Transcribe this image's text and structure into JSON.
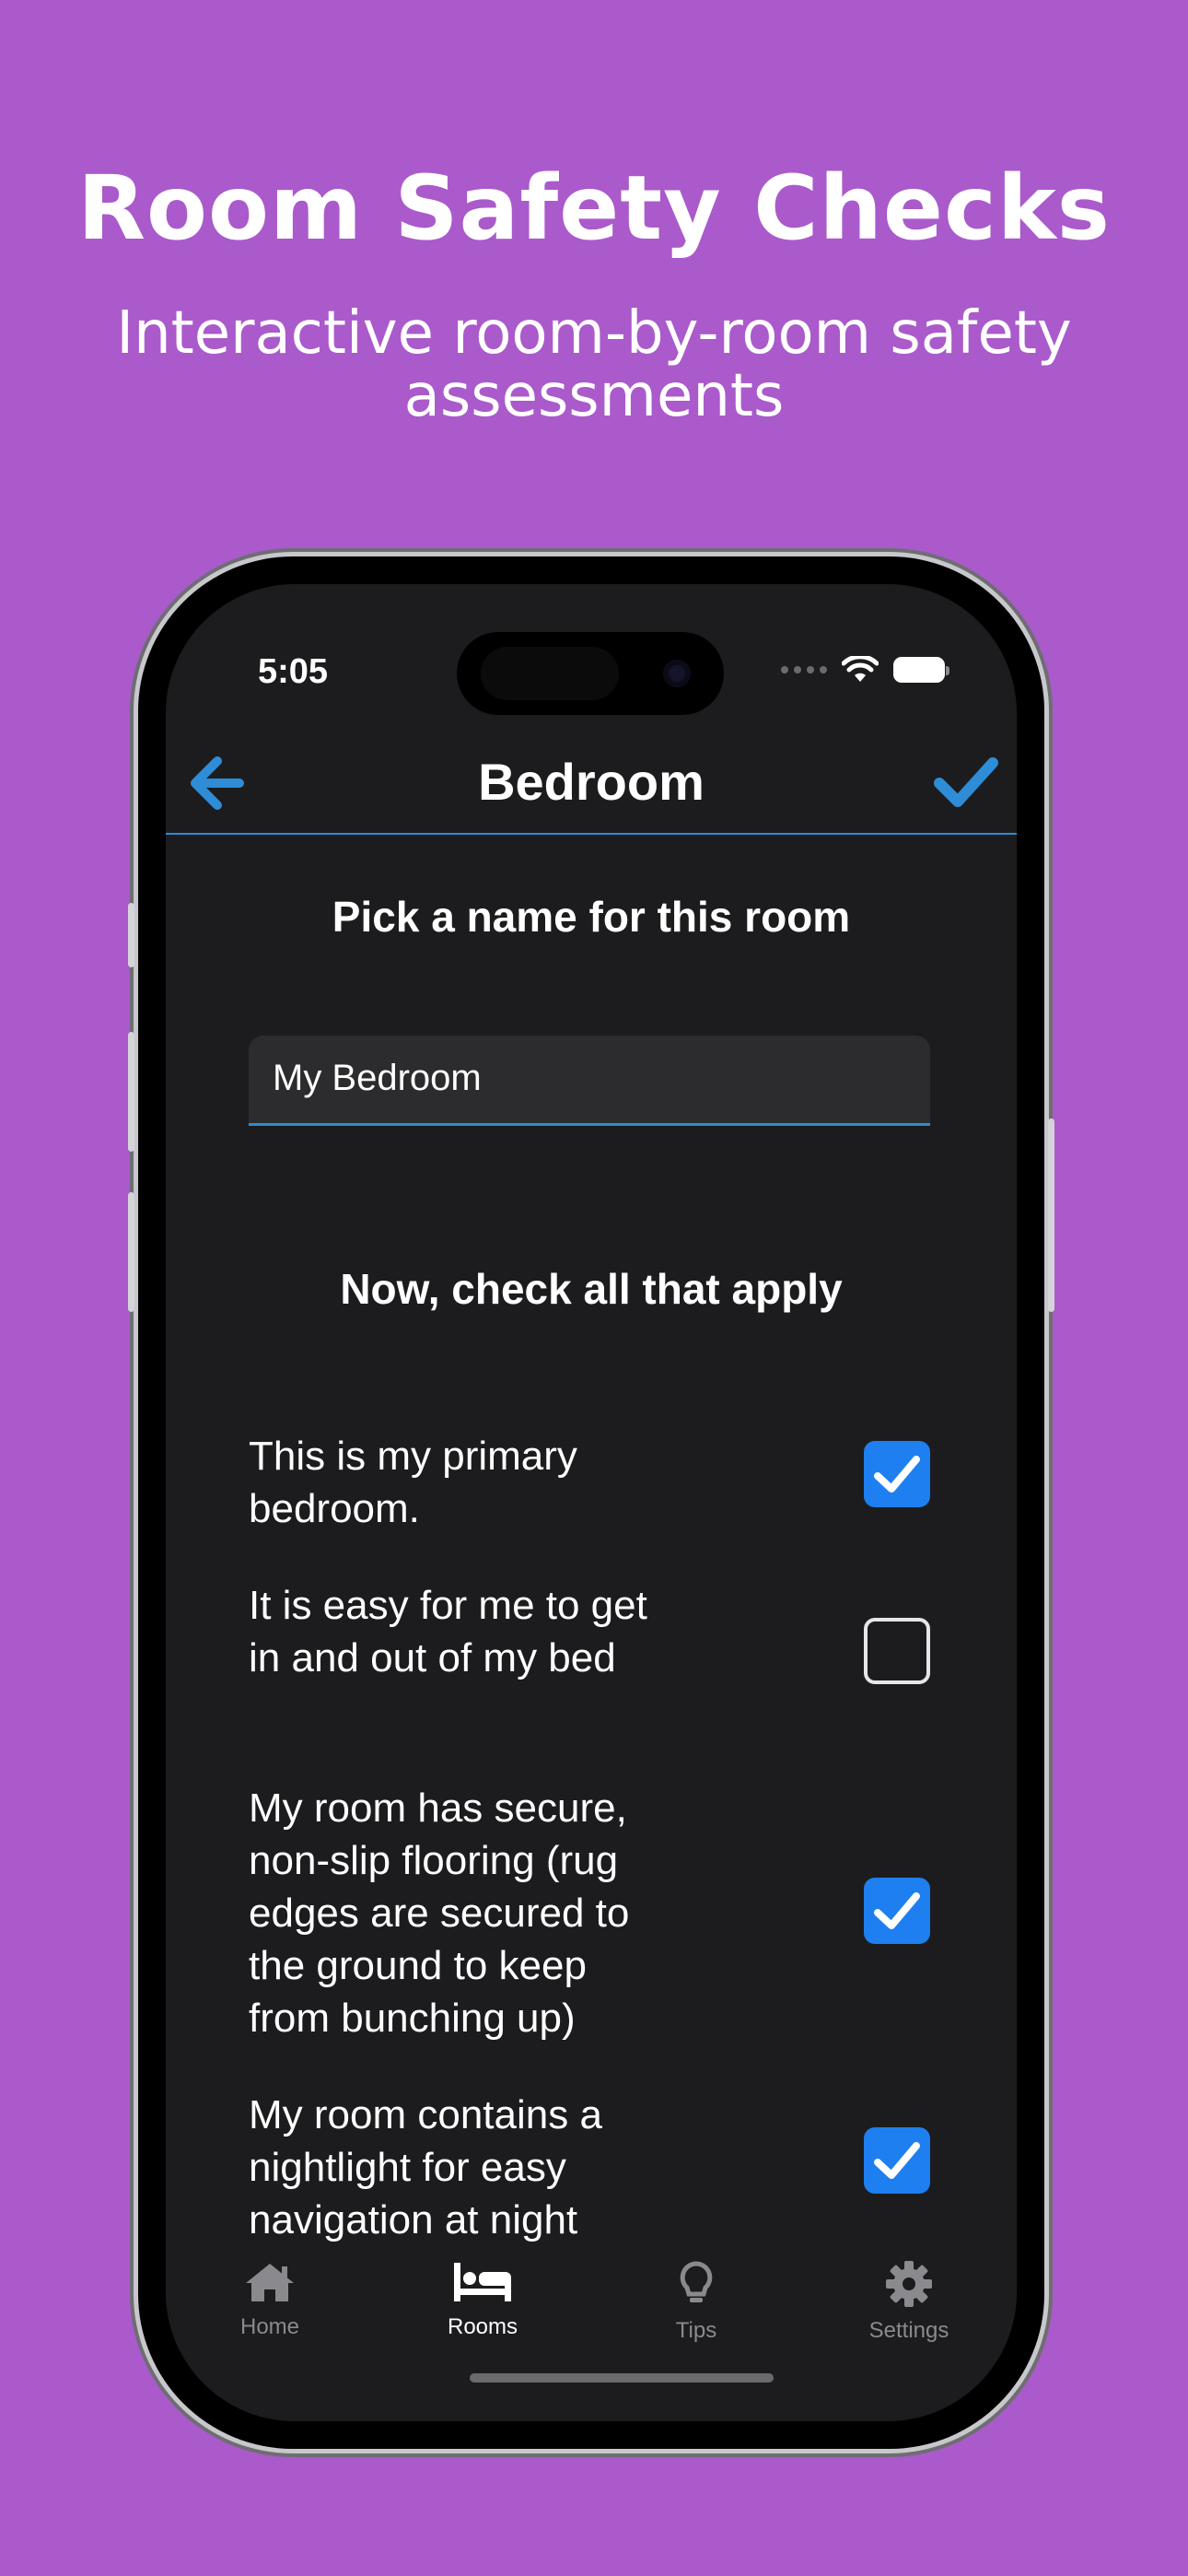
{
  "promo": {
    "headline": "Room Safety Checks",
    "subheadline": "Interactive room-by-room safety assessments"
  },
  "status_bar": {
    "time": "5:05"
  },
  "nav": {
    "title": "Bedroom",
    "back_icon": "arrow-left-icon",
    "done_icon": "checkmark-icon",
    "accent_color": "#2f8cd6"
  },
  "room_name": {
    "prompt": "Pick a name for this room",
    "value": "My Bedroom"
  },
  "checklist": {
    "prompt": "Now, check all that apply",
    "items": [
      {
        "label": "This is my primary bedroom.",
        "checked": true
      },
      {
        "label": "It is easy for me to get in and out of my bed",
        "checked": false
      },
      {
        "label": "My room has secure, non-slip flooring (rug edges are secured to the ground to keep from bunching up)",
        "checked": true
      },
      {
        "label": "My room contains a nightlight for easy navigation at night",
        "checked": true
      }
    ]
  },
  "tabbar": {
    "tabs": [
      {
        "label": "Home",
        "icon": "house-icon",
        "active": false
      },
      {
        "label": "Rooms",
        "icon": "bed-icon",
        "active": true
      },
      {
        "label": "Tips",
        "icon": "lightbulb-icon",
        "active": false
      },
      {
        "label": "Settings",
        "icon": "gear-icon",
        "active": false
      }
    ]
  },
  "colors": {
    "background": "#aa5acb",
    "screen": "#1c1c1e",
    "checkbox_on": "#1e7ff0"
  }
}
